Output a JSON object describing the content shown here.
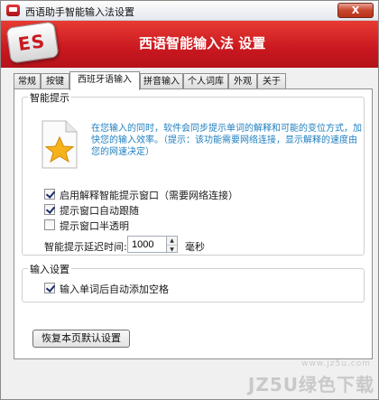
{
  "window": {
    "title": "西语助手智能输入法设置",
    "close_label": "X",
    "banner_title": "西语智能输入法 设置",
    "logo_text": "ES"
  },
  "tabs": [
    {
      "label": "常规",
      "active": false
    },
    {
      "label": "按键",
      "active": false
    },
    {
      "label": "西班牙语输入",
      "active": true
    },
    {
      "label": "拼音输入",
      "active": false
    },
    {
      "label": "个人词库",
      "active": false
    },
    {
      "label": "外观",
      "active": false
    },
    {
      "label": "关于",
      "active": false
    }
  ],
  "smart_hint": {
    "group_title": "智能提示",
    "info_text": "在您输入的同时，软件会同步提示单词的解释和可能的变位方式，加快您的输入效率。（提示：该功能需要网络连接，显示解释的速度由您的网速决定）",
    "options": [
      {
        "label": "启用解释智能提示窗口（需要网络连接）",
        "checked": true
      },
      {
        "label": "提示窗口自动跟随",
        "checked": true
      },
      {
        "label": "提示窗口半透明",
        "checked": false
      }
    ],
    "delay_label": "智能提示延迟时间:",
    "delay_value": "1000",
    "delay_unit": "毫秒"
  },
  "input_settings": {
    "group_title": "输入设置",
    "options": [
      {
        "label": "输入单词后自动添加空格",
        "checked": true
      }
    ]
  },
  "reset_button": "恢复本页默认设置",
  "watermark": {
    "text": "JZ5U绿色下载",
    "url": "www.jz5u.com"
  },
  "colors": {
    "banner": "#c91820",
    "info_text": "#1f7fbf"
  }
}
